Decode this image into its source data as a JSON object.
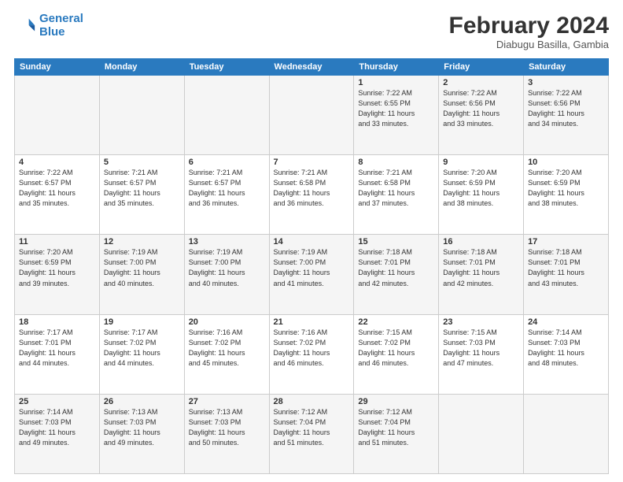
{
  "logo": {
    "line1": "General",
    "line2": "Blue"
  },
  "header": {
    "title": "February 2024",
    "location": "Diabugu Basilla, Gambia"
  },
  "weekdays": [
    "Sunday",
    "Monday",
    "Tuesday",
    "Wednesday",
    "Thursday",
    "Friday",
    "Saturday"
  ],
  "weeks": [
    [
      {
        "day": "",
        "info": ""
      },
      {
        "day": "",
        "info": ""
      },
      {
        "day": "",
        "info": ""
      },
      {
        "day": "",
        "info": ""
      },
      {
        "day": "1",
        "info": "Sunrise: 7:22 AM\nSunset: 6:55 PM\nDaylight: 11 hours\nand 33 minutes."
      },
      {
        "day": "2",
        "info": "Sunrise: 7:22 AM\nSunset: 6:56 PM\nDaylight: 11 hours\nand 33 minutes."
      },
      {
        "day": "3",
        "info": "Sunrise: 7:22 AM\nSunset: 6:56 PM\nDaylight: 11 hours\nand 34 minutes."
      }
    ],
    [
      {
        "day": "4",
        "info": "Sunrise: 7:22 AM\nSunset: 6:57 PM\nDaylight: 11 hours\nand 35 minutes."
      },
      {
        "day": "5",
        "info": "Sunrise: 7:21 AM\nSunset: 6:57 PM\nDaylight: 11 hours\nand 35 minutes."
      },
      {
        "day": "6",
        "info": "Sunrise: 7:21 AM\nSunset: 6:57 PM\nDaylight: 11 hours\nand 36 minutes."
      },
      {
        "day": "7",
        "info": "Sunrise: 7:21 AM\nSunset: 6:58 PM\nDaylight: 11 hours\nand 36 minutes."
      },
      {
        "day": "8",
        "info": "Sunrise: 7:21 AM\nSunset: 6:58 PM\nDaylight: 11 hours\nand 37 minutes."
      },
      {
        "day": "9",
        "info": "Sunrise: 7:20 AM\nSunset: 6:59 PM\nDaylight: 11 hours\nand 38 minutes."
      },
      {
        "day": "10",
        "info": "Sunrise: 7:20 AM\nSunset: 6:59 PM\nDaylight: 11 hours\nand 38 minutes."
      }
    ],
    [
      {
        "day": "11",
        "info": "Sunrise: 7:20 AM\nSunset: 6:59 PM\nDaylight: 11 hours\nand 39 minutes."
      },
      {
        "day": "12",
        "info": "Sunrise: 7:19 AM\nSunset: 7:00 PM\nDaylight: 11 hours\nand 40 minutes."
      },
      {
        "day": "13",
        "info": "Sunrise: 7:19 AM\nSunset: 7:00 PM\nDaylight: 11 hours\nand 40 minutes."
      },
      {
        "day": "14",
        "info": "Sunrise: 7:19 AM\nSunset: 7:00 PM\nDaylight: 11 hours\nand 41 minutes."
      },
      {
        "day": "15",
        "info": "Sunrise: 7:18 AM\nSunset: 7:01 PM\nDaylight: 11 hours\nand 42 minutes."
      },
      {
        "day": "16",
        "info": "Sunrise: 7:18 AM\nSunset: 7:01 PM\nDaylight: 11 hours\nand 42 minutes."
      },
      {
        "day": "17",
        "info": "Sunrise: 7:18 AM\nSunset: 7:01 PM\nDaylight: 11 hours\nand 43 minutes."
      }
    ],
    [
      {
        "day": "18",
        "info": "Sunrise: 7:17 AM\nSunset: 7:01 PM\nDaylight: 11 hours\nand 44 minutes."
      },
      {
        "day": "19",
        "info": "Sunrise: 7:17 AM\nSunset: 7:02 PM\nDaylight: 11 hours\nand 44 minutes."
      },
      {
        "day": "20",
        "info": "Sunrise: 7:16 AM\nSunset: 7:02 PM\nDaylight: 11 hours\nand 45 minutes."
      },
      {
        "day": "21",
        "info": "Sunrise: 7:16 AM\nSunset: 7:02 PM\nDaylight: 11 hours\nand 46 minutes."
      },
      {
        "day": "22",
        "info": "Sunrise: 7:15 AM\nSunset: 7:02 PM\nDaylight: 11 hours\nand 46 minutes."
      },
      {
        "day": "23",
        "info": "Sunrise: 7:15 AM\nSunset: 7:03 PM\nDaylight: 11 hours\nand 47 minutes."
      },
      {
        "day": "24",
        "info": "Sunrise: 7:14 AM\nSunset: 7:03 PM\nDaylight: 11 hours\nand 48 minutes."
      }
    ],
    [
      {
        "day": "25",
        "info": "Sunrise: 7:14 AM\nSunset: 7:03 PM\nDaylight: 11 hours\nand 49 minutes."
      },
      {
        "day": "26",
        "info": "Sunrise: 7:13 AM\nSunset: 7:03 PM\nDaylight: 11 hours\nand 49 minutes."
      },
      {
        "day": "27",
        "info": "Sunrise: 7:13 AM\nSunset: 7:03 PM\nDaylight: 11 hours\nand 50 minutes."
      },
      {
        "day": "28",
        "info": "Sunrise: 7:12 AM\nSunset: 7:04 PM\nDaylight: 11 hours\nand 51 minutes."
      },
      {
        "day": "29",
        "info": "Sunrise: 7:12 AM\nSunset: 7:04 PM\nDaylight: 11 hours\nand 51 minutes."
      },
      {
        "day": "",
        "info": ""
      },
      {
        "day": "",
        "info": ""
      }
    ]
  ]
}
